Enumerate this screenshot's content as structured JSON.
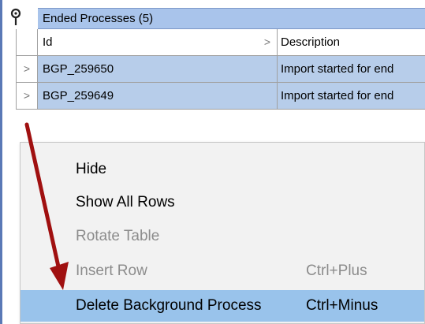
{
  "group": {
    "title": "Ended Processes (5)"
  },
  "grid": {
    "columns": {
      "id": "Id",
      "description": "Description"
    },
    "rows": [
      {
        "id": "BGP_259650",
        "description": "Import started for end"
      },
      {
        "id": "BGP_259649",
        "description": "Import started for end"
      }
    ]
  },
  "context_menu": {
    "items": [
      {
        "label": "Hide",
        "shortcut": "",
        "state": "enabled"
      },
      {
        "label": "Show All Rows",
        "shortcut": "",
        "state": "enabled"
      },
      {
        "label": "Rotate Table",
        "shortcut": "",
        "state": "disabled"
      },
      {
        "label": "Insert Row",
        "shortcut": "Ctrl+Plus",
        "state": "disabled"
      },
      {
        "label": "Delete Background Process",
        "shortcut": "Ctrl+Minus",
        "state": "highlighted"
      }
    ]
  },
  "colors": {
    "selection": "#b7cdea",
    "menu_highlight": "#99c3eb",
    "annotation_arrow": "#a01010",
    "group_header": "#a9c4eb"
  },
  "icons": {
    "pin": "pin-icon",
    "expander": "chevron-right-icon"
  }
}
